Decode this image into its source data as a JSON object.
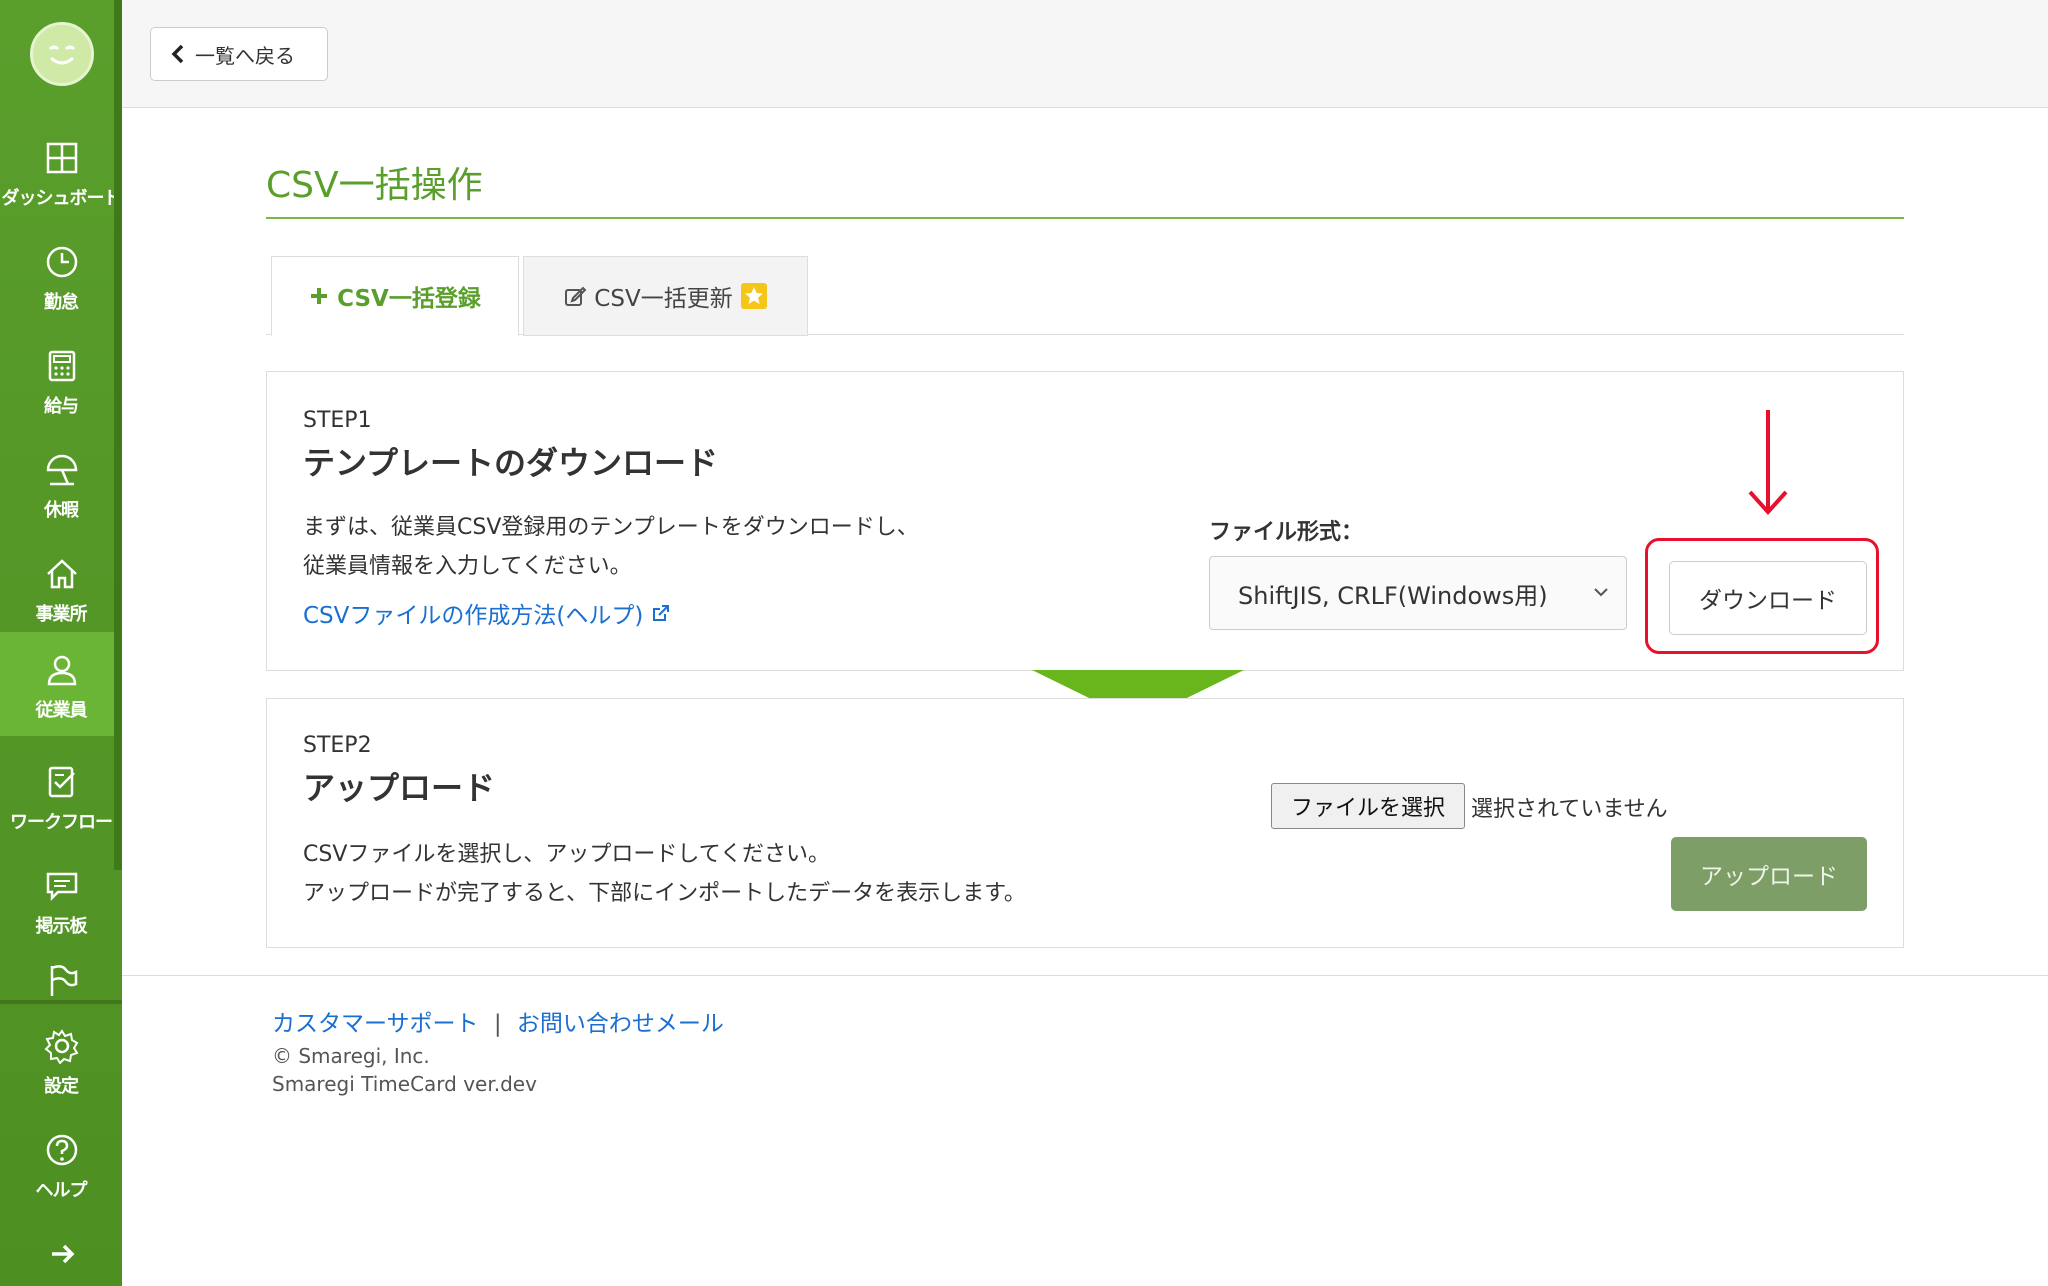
{
  "sidebar": {
    "items": [
      {
        "label": "ダッシュボード",
        "icon": "dashboard-icon"
      },
      {
        "label": "勤怠",
        "icon": "clock-icon"
      },
      {
        "label": "給与",
        "icon": "calculator-icon"
      },
      {
        "label": "休暇",
        "icon": "beach-umbrella-icon"
      },
      {
        "label": "事業所",
        "icon": "home-icon"
      },
      {
        "label": "従業員",
        "icon": "person-icon"
      },
      {
        "label": "ワークフロー",
        "icon": "checklist-icon"
      },
      {
        "label": "掲示板",
        "icon": "chat-icon"
      },
      {
        "label": "",
        "icon": "flag-icon"
      },
      {
        "label": "設定",
        "icon": "gear-icon"
      },
      {
        "label": "ヘルプ",
        "icon": "help-icon"
      }
    ],
    "active_index": 5,
    "expand_icon": "arrow-right-icon"
  },
  "topbar": {
    "back_label": "一覧へ戻る"
  },
  "page": {
    "title": "CSV一括操作"
  },
  "tabs": [
    {
      "label": "CSV一括登録",
      "icon": "plus-icon",
      "active": true
    },
    {
      "label": "CSV一括更新",
      "icon": "edit-icon",
      "badge_icon": "star-icon",
      "active": false
    }
  ],
  "step1": {
    "step": "STEP1",
    "title": "テンプレートのダウンロード",
    "desc_line1": "まずは、従業員CSV登録用のテンプレートをダウンロードし、",
    "desc_line2": "従業員情報を入力してください。",
    "help_link": "CSVファイルの作成方法(ヘルプ)",
    "format_label": "ファイル形式：",
    "format_selected": "ShiftJIS, CRLF(Windows用)",
    "download_label": "ダウンロード"
  },
  "step2": {
    "step": "STEP2",
    "title": "アップロード",
    "desc_line1": "CSVファイルを選択し、アップロードしてください。",
    "desc_line2": "アップロードが完了すると、下部にインポートしたデータを表示します。",
    "file_button": "ファイルを選択",
    "file_status": "選択されていません",
    "upload_label": "アップロード"
  },
  "footer": {
    "support_link": "カスタマーサポート",
    "separator": "|",
    "contact_link": "お問い合わせメール",
    "copyright": "© Smaregi, Inc.",
    "version": "Smaregi TimeCard ver.dev"
  },
  "colors": {
    "sidebar": "#5a9e2c",
    "accent": "#5a9e2c",
    "annotation": "#e8112d",
    "link": "#1a6fd1"
  }
}
